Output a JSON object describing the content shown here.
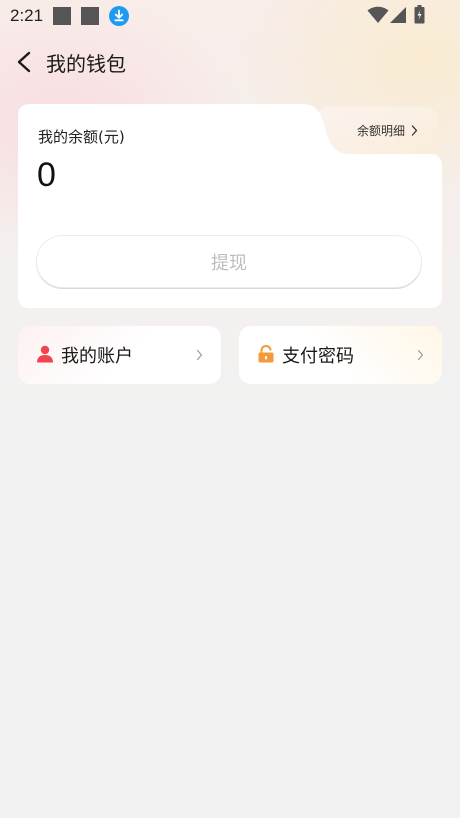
{
  "status_bar": {
    "time": "2:21"
  },
  "header": {
    "title": "我的钱包",
    "back_icon": "chevron-left-icon"
  },
  "balance_card": {
    "label": "我的余额(元)",
    "value": "0",
    "detail_link": "余额明细",
    "withdraw_label": "提现"
  },
  "shortcuts": [
    {
      "label": "我的账户",
      "icon": "person-icon",
      "icon_color": "#f0454f"
    },
    {
      "label": "支付密码",
      "icon": "lock-icon",
      "icon_color": "#f59a3c"
    }
  ],
  "colors": {
    "background": "#f2f2f2",
    "card": "#ffffff",
    "disabled_text": "#bdbdbd",
    "download_badge": "#1e9bf0"
  }
}
